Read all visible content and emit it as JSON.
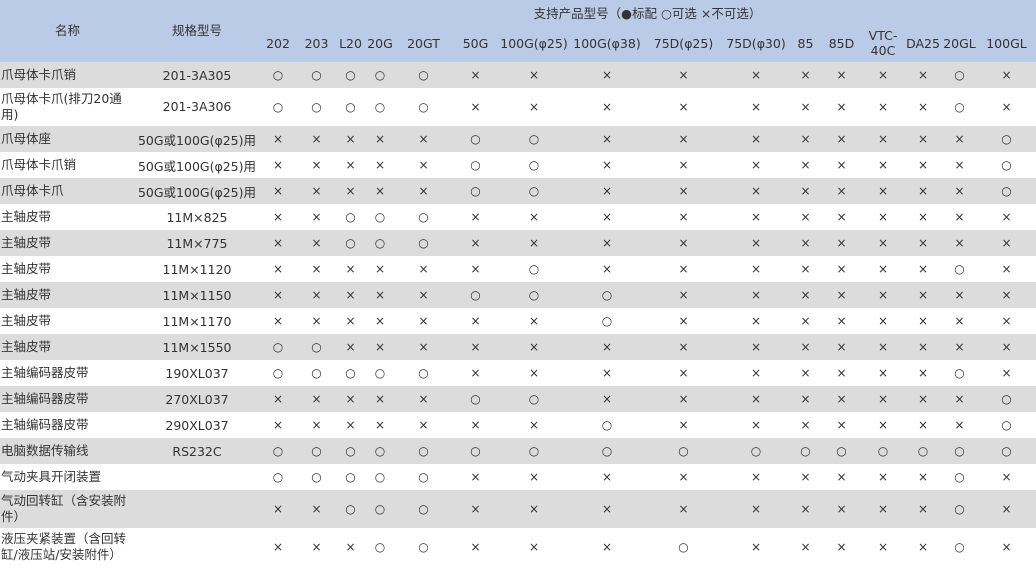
{
  "table": {
    "header": {
      "name": "名称",
      "spec": "规格型号",
      "group": "支持产品型号（●标配  ○可选  ×不可选）",
      "models": [
        "202",
        "203",
        "L20",
        "20G",
        "20GT",
        "50G",
        "100G(φ25)",
        "100G(φ38)",
        "75D(φ25)",
        "75D(φ30)",
        "85",
        "85D",
        "VTC-40C",
        "DA25",
        "20GL",
        "100GL"
      ]
    },
    "rows": [
      {
        "name": "爪母体卡爪销",
        "spec": "201-3A305",
        "marks": [
          "○",
          "○",
          "○",
          "○",
          "○",
          "×",
          "×",
          "×",
          "×",
          "×",
          "×",
          "×",
          "×",
          "×",
          "○",
          "×"
        ]
      },
      {
        "name": "爪母体卡爪(排刀20通用)",
        "spec": "201-3A306",
        "marks": [
          "○",
          "○",
          "○",
          "○",
          "○",
          "×",
          "×",
          "×",
          "×",
          "×",
          "×",
          "×",
          "×",
          "×",
          "○",
          "×"
        ]
      },
      {
        "name": "爪母体座",
        "spec": "50G或100G(φ25)用",
        "marks": [
          "×",
          "×",
          "×",
          "×",
          "×",
          "○",
          "○",
          "×",
          "×",
          "×",
          "×",
          "×",
          "×",
          "×",
          "×",
          "○"
        ]
      },
      {
        "name": "爪母体卡爪销",
        "spec": "50G或100G(φ25)用",
        "marks": [
          "×",
          "×",
          "×",
          "×",
          "×",
          "○",
          "○",
          "×",
          "×",
          "×",
          "×",
          "×",
          "×",
          "×",
          "×",
          "○"
        ]
      },
      {
        "name": "爪母体卡爪",
        "spec": "50G或100G(φ25)用",
        "marks": [
          "×",
          "×",
          "×",
          "×",
          "×",
          "○",
          "○",
          "×",
          "×",
          "×",
          "×",
          "×",
          "×",
          "×",
          "×",
          "○"
        ]
      },
      {
        "name": "主轴皮带",
        "spec": "11M×825",
        "marks": [
          "×",
          "×",
          "○",
          "○",
          "○",
          "×",
          "×",
          "×",
          "×",
          "×",
          "×",
          "×",
          "×",
          "×",
          "×",
          "×"
        ]
      },
      {
        "name": "主轴皮带",
        "spec": "11M×775",
        "marks": [
          "×",
          "×",
          "○",
          "○",
          "○",
          "×",
          "×",
          "×",
          "×",
          "×",
          "×",
          "×",
          "×",
          "×",
          "×",
          "×"
        ]
      },
      {
        "name": "主轴皮带",
        "spec": "11M×1120",
        "marks": [
          "×",
          "×",
          "×",
          "×",
          "×",
          "×",
          "○",
          "×",
          "×",
          "×",
          "×",
          "×",
          "×",
          "×",
          "○",
          "×"
        ]
      },
      {
        "name": "主轴皮带",
        "spec": "11M×1150",
        "marks": [
          "×",
          "×",
          "×",
          "×",
          "×",
          "○",
          "○",
          "○",
          "×",
          "×",
          "×",
          "×",
          "×",
          "×",
          "×",
          "×"
        ]
      },
      {
        "name": "主轴皮带",
        "spec": "11M×1170",
        "marks": [
          "×",
          "×",
          "×",
          "×",
          "×",
          "×",
          "×",
          "○",
          "×",
          "×",
          "×",
          "×",
          "×",
          "×",
          "×",
          "×"
        ]
      },
      {
        "name": "主轴皮带",
        "spec": "11M×1550",
        "marks": [
          "○",
          "○",
          "×",
          "×",
          "×",
          "×",
          "×",
          "×",
          "×",
          "×",
          "×",
          "×",
          "×",
          "×",
          "×",
          "×"
        ]
      },
      {
        "name": "主轴编码器皮带",
        "spec": "190XL037",
        "marks": [
          "○",
          "○",
          "○",
          "○",
          "○",
          "×",
          "×",
          "×",
          "×",
          "×",
          "×",
          "×",
          "×",
          "×",
          "○",
          "×"
        ]
      },
      {
        "name": "主轴编码器皮带",
        "spec": "270XL037",
        "marks": [
          "×",
          "×",
          "×",
          "×",
          "×",
          "○",
          "○",
          "×",
          "×",
          "×",
          "×",
          "×",
          "×",
          "×",
          "×",
          "○"
        ]
      },
      {
        "name": "主轴编码器皮带",
        "spec": "290XL037",
        "marks": [
          "×",
          "×",
          "×",
          "×",
          "×",
          "×",
          "×",
          "○",
          "×",
          "×",
          "×",
          "×",
          "×",
          "×",
          "×",
          "○"
        ]
      },
      {
        "name": "电脑数据传输线",
        "spec": "RS232C",
        "marks": [
          "○",
          "○",
          "○",
          "○",
          "○",
          "○",
          "○",
          "○",
          "○",
          "○",
          "○",
          "○",
          "○",
          "○",
          "○",
          "○"
        ]
      },
      {
        "name": "气动夹具开闭装置",
        "spec": "",
        "marks": [
          "○",
          "○",
          "○",
          "○",
          "○",
          "×",
          "×",
          "×",
          "×",
          "×",
          "×",
          "×",
          "×",
          "×",
          "○",
          "×"
        ]
      },
      {
        "name": "气动回转缸（含安装附件）",
        "spec": "",
        "marks": [
          "×",
          "×",
          "○",
          "○",
          "○",
          "×",
          "×",
          "×",
          "×",
          "×",
          "×",
          "×",
          "×",
          "×",
          "○",
          "×"
        ]
      },
      {
        "name": "液压夹紧装置（含回转缸/液压站/安装附件）",
        "spec": "",
        "marks": [
          "×",
          "×",
          "×",
          "○",
          "○",
          "×",
          "×",
          "×",
          "○",
          "×",
          "×",
          "×",
          "×",
          "×",
          "○",
          "×"
        ]
      }
    ]
  }
}
